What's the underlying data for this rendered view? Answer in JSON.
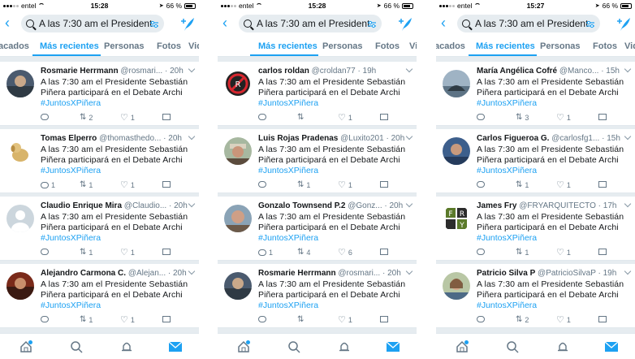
{
  "colors": {
    "accent": "#1da1f2",
    "text": "#14171a",
    "muted": "#657786",
    "background": "#e6ecf0"
  },
  "screens": [
    {
      "status": {
        "carrier": "entel",
        "time": "15:28",
        "battery": "66 %"
      },
      "search": {
        "query": "A las 7:30 am el Presidente..."
      },
      "tabs": [
        "acados",
        "Más recientes",
        "Personas",
        "Fotos",
        "Vid"
      ],
      "active_tab": 1,
      "tweets": [
        {
          "name": "Rosmarie Herrmann",
          "handle": "@rosmari...",
          "time": "· 20h",
          "text": "A las 7:30 am el Presidente Sebastián Piñera participará en el Debate Archi",
          "hashtag": "#JuntosXPiñera",
          "replies": "",
          "retweets": "2",
          "likes": "1",
          "avatar": "photo-dark"
        },
        {
          "name": "Tomas Elperro",
          "handle": "@thomasthedo...",
          "time": "· 20h",
          "text": "A las 7:30 am el Presidente Sebastián Piñera participará en el Debate Archi",
          "hashtag": "#JuntosXPiñera",
          "replies": "1",
          "retweets": "1",
          "likes": "1",
          "avatar": "dog"
        },
        {
          "name": "Claudio Enrique Mira",
          "handle": "@Claudio...",
          "time": "· 20h",
          "text": "A las 7:30 am el Presidente Sebastián Piñera participará en el Debate Archi",
          "hashtag": "#JuntosXPiñera",
          "replies": "",
          "retweets": "1",
          "likes": "1",
          "avatar": "default"
        },
        {
          "name": "Alejandro Carmona C.",
          "handle": "@Alejan...",
          "time": "· 20h",
          "text": "A las 7:30 am el Presidente Sebastián Piñera participará en el Debate Archi",
          "hashtag": "#JuntosXPiñera",
          "replies": "",
          "retweets": "1",
          "likes": "1",
          "avatar": "photo-red"
        }
      ]
    },
    {
      "status": {
        "carrier": "entel",
        "time": "15:28",
        "battery": "66 %"
      },
      "search": {
        "query": "A las 7:30 am el Presidente..."
      },
      "tabs": [
        "Más recientes",
        "Personas",
        "Fotos",
        "Vid"
      ],
      "active_tab": 0,
      "tweets": [
        {
          "name": "carlos roldan",
          "handle": "@croldan77",
          "time": "· 19h",
          "text": "A las 7:30 am el Presidente Sebastián Piñera participará en el Debate Archi",
          "hashtag": "#JuntosXPiñera",
          "replies": "",
          "retweets": "",
          "likes": "1",
          "avatar": "no-sign"
        },
        {
          "name": "Luis Rojas Pradenas",
          "handle": "@Luxito201",
          "time": "· 20h",
          "text": "A las 7:30 am el Presidente Sebastián Piñera participará en el Debate Archi",
          "hashtag": "#JuntosXPiñera",
          "replies": "",
          "retweets": "1",
          "likes": "1",
          "avatar": "photo-hat"
        },
        {
          "name": "Gonzalo Townsend P.2",
          "handle": "@Gonz...",
          "time": "· 20h",
          "text": "A las 7:30 am el Presidente Sebastián Piñera participará en el Debate Archi",
          "hashtag": "#JuntosXPiñera",
          "replies": "1",
          "retweets": "4",
          "likes": "6",
          "avatar": "photo-man"
        },
        {
          "name": "Rosmarie Herrmann",
          "handle": "@rosmari...",
          "time": "· 20h",
          "text": "A las 7:30 am el Presidente Sebastián Piñera participará en el Debate Archi",
          "hashtag": "#JuntosXPiñera",
          "replies": "",
          "retweets": "",
          "likes": "1",
          "avatar": "photo-dark"
        }
      ]
    },
    {
      "status": {
        "carrier": "entel",
        "time": "15:27",
        "battery": "66 %"
      },
      "search": {
        "query": "A las 7:30 am el Presidente..."
      },
      "tabs": [
        "acados",
        "Más recientes",
        "Personas",
        "Fotos",
        "Vid"
      ],
      "active_tab": 1,
      "tweets": [
        {
          "name": "María Angélica Cofré",
          "handle": "@Manco...",
          "time": "· 15h",
          "text": "A las 7:30 am el Presidente Sebastián Piñera participará en el Debate Archi",
          "hashtag": "#JuntosXPiñera",
          "replies": "",
          "retweets": "3",
          "likes": "1",
          "avatar": "photo-sea"
        },
        {
          "name": "Carlos Figueroa G.",
          "handle": "@carlosfg1...",
          "time": "· 15h",
          "text": "A las 7:30 am el Presidente Sebastián Piñera participará en el Debate Archi",
          "hashtag": "#JuntosXPiñera",
          "replies": "",
          "retweets": "1",
          "likes": "1",
          "avatar": "photo-blue"
        },
        {
          "name": "James Fry",
          "handle": "@FRYARQUITECTO",
          "time": "· 17h",
          "text": "A las 7:30 am el Presidente Sebastián Piñera participará en el Debate Archi",
          "hashtag": "#JuntosXPiñera",
          "replies": "",
          "retweets": "1",
          "likes": "1",
          "avatar": "fry-logo"
        },
        {
          "name": "Patricio Silva P",
          "handle": "@PatricioSilvaP",
          "time": "· 19h",
          "text": "A las 7:30 am el Presidente Sebastián Piñera participará en el Debate Archi",
          "hashtag": "#JuntosXPiñera",
          "replies": "",
          "retweets": "2",
          "likes": "1",
          "avatar": "photo-woman"
        }
      ]
    }
  ]
}
